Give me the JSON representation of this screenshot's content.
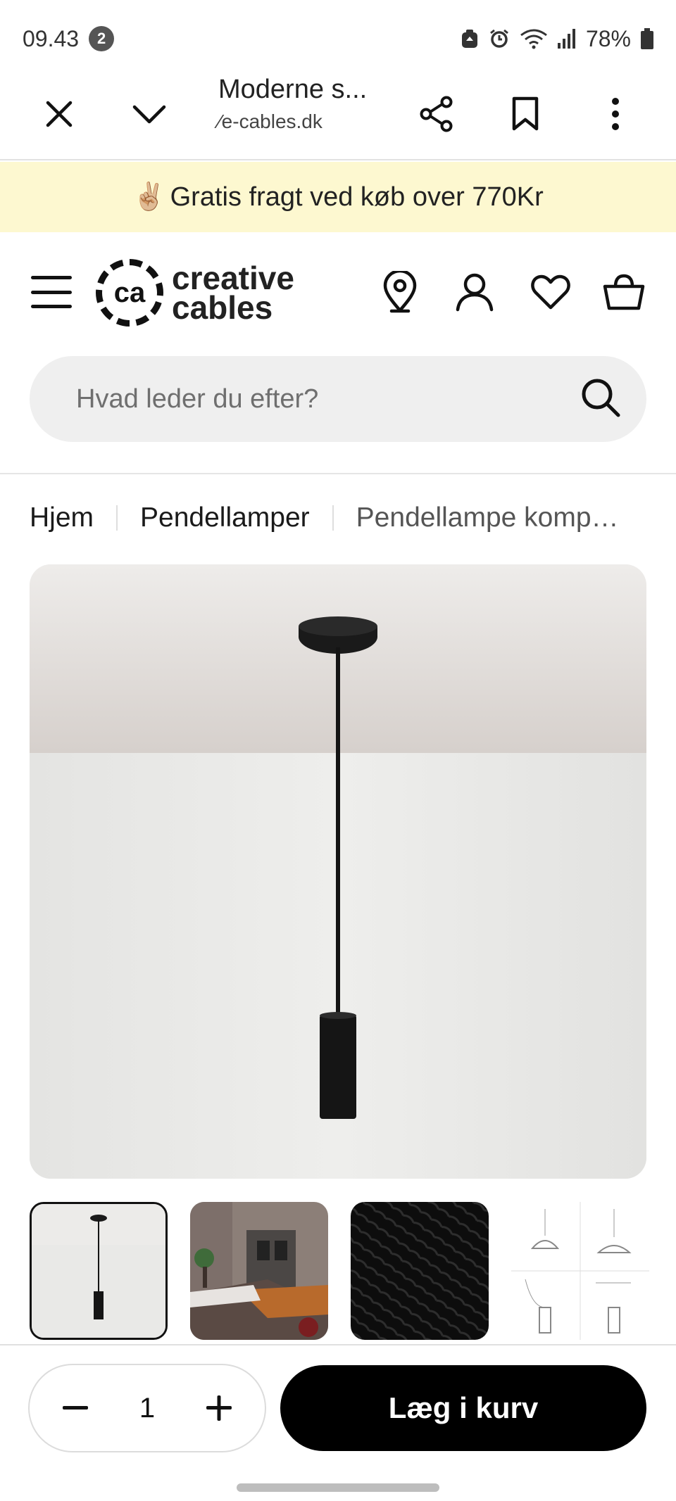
{
  "status_bar": {
    "time": "09.43",
    "notification_count": "2",
    "battery": "78%"
  },
  "custom_tab": {
    "title": "Moderne s...",
    "url": "⁄e-cables.dk",
    "close_icon": "close-icon",
    "minimize_icon": "chevron-down-icon",
    "share_icon": "share-icon",
    "bookmark_icon": "bookmark-icon",
    "menu_icon": "more-vertical-icon"
  },
  "promo": {
    "emoji": "✌🏼",
    "text": "Gratis fragt ved køb over 770Kr",
    "background": "#fdf8d0"
  },
  "header": {
    "logo_mark": "ca",
    "logo_line1": "creative",
    "logo_line2": "cables",
    "icons": [
      "location-pin-icon",
      "account-icon",
      "heart-icon",
      "basket-icon"
    ]
  },
  "search": {
    "placeholder": "Hvad leder du efter?"
  },
  "breadcrumb": {
    "items": [
      "Hjem",
      "Pendellamper",
      "Pendellampe komp…"
    ]
  },
  "gallery": {
    "thumbnails": [
      "pendant-lamp-thumbnail",
      "kitchen-scene-thumbnail",
      "black-fabric-cable-thumbnail",
      "technical-drawing-thumbnail"
    ],
    "active_index": 0
  },
  "cart_bar": {
    "quantity": "1",
    "add_to_cart_label": "Læg i kurv",
    "button_color": "#000000"
  }
}
